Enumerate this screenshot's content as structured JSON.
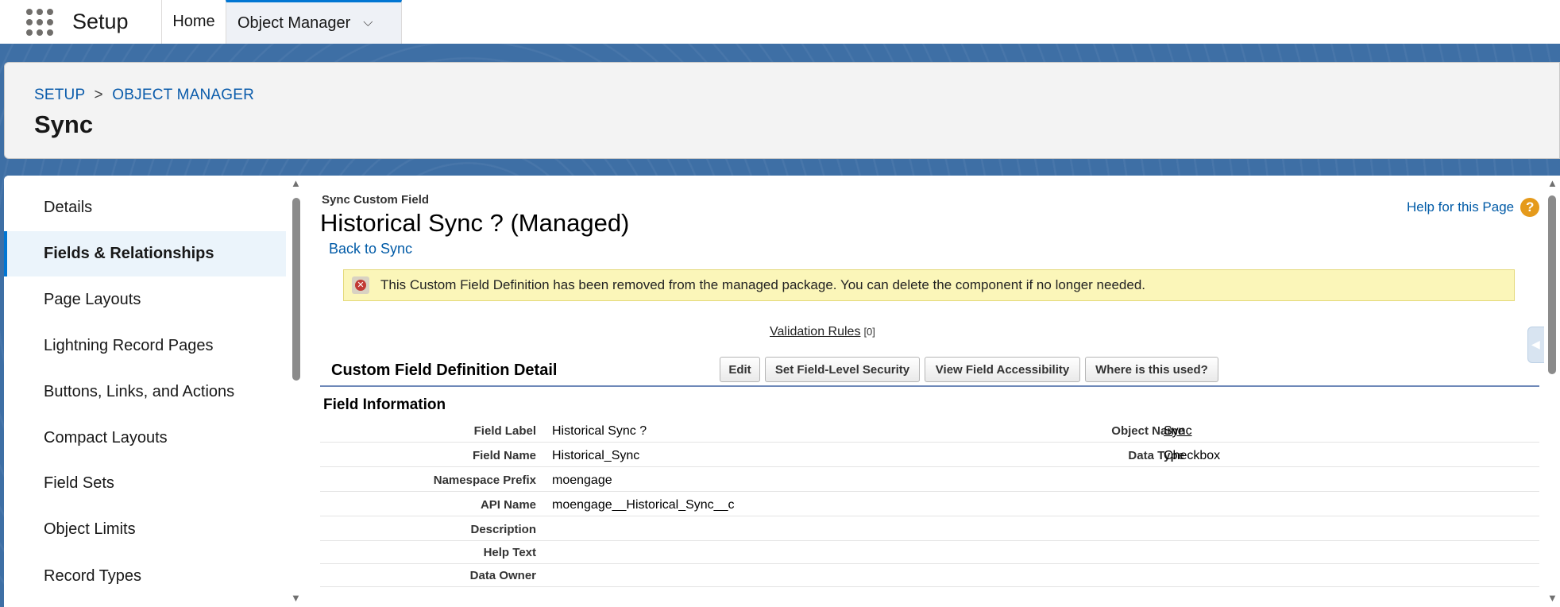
{
  "app": {
    "name": "Setup"
  },
  "tabs": [
    {
      "label": "Home"
    },
    {
      "label": "Object Manager"
    }
  ],
  "header": {
    "breadcrumb": [
      "SETUP",
      ">",
      "OBJECT MANAGER"
    ],
    "title": "Sync"
  },
  "sidebar": {
    "items": [
      {
        "label": "Details"
      },
      {
        "label": "Fields & Relationships"
      },
      {
        "label": "Page Layouts"
      },
      {
        "label": "Lightning Record Pages"
      },
      {
        "label": "Buttons, Links, and Actions"
      },
      {
        "label": "Compact Layouts"
      },
      {
        "label": "Field Sets"
      },
      {
        "label": "Object Limits"
      },
      {
        "label": "Record Types"
      }
    ],
    "active_index": 1
  },
  "content": {
    "type_label": "Sync Custom Field",
    "record_title": "Historical Sync ? (Managed)",
    "back_link": "Back to Sync",
    "help_link": "Help for this Page",
    "help_icon": "?",
    "alert": "This Custom Field Definition has been removed from the managed package. You can delete the component if no longer needed.",
    "related": {
      "label": "Validation Rules",
      "count": "[0]"
    },
    "section_title": "Custom Field Definition Detail",
    "buttons": {
      "edit": "Edit",
      "fls": "Set Field-Level Security",
      "vfa": "View Field Accessibility",
      "where": "Where is this used?"
    },
    "subsection_title": "Field Information",
    "fields": [
      {
        "label": "Field Label",
        "value": "Historical Sync ?",
        "label2": "Object Name",
        "value2": "Sync"
      },
      {
        "label": "Field Name",
        "value": "Historical_Sync",
        "label2": "Data Type",
        "value2": "Checkbox"
      },
      {
        "label": "Namespace Prefix",
        "value": "moengage"
      },
      {
        "label": "API Name",
        "value": "moengage__Historical_Sync__c"
      },
      {
        "label": "Description",
        "value": ""
      },
      {
        "label": "Help Text",
        "value": ""
      },
      {
        "label": "Data Owner",
        "value": ""
      }
    ]
  },
  "colors": {
    "brand_blue": "#0176d3",
    "band_blue": "#3e6fa5",
    "link_blue": "#015ba7",
    "alert_bg": "#fbf6b9",
    "help_orange": "#e59a1b"
  }
}
